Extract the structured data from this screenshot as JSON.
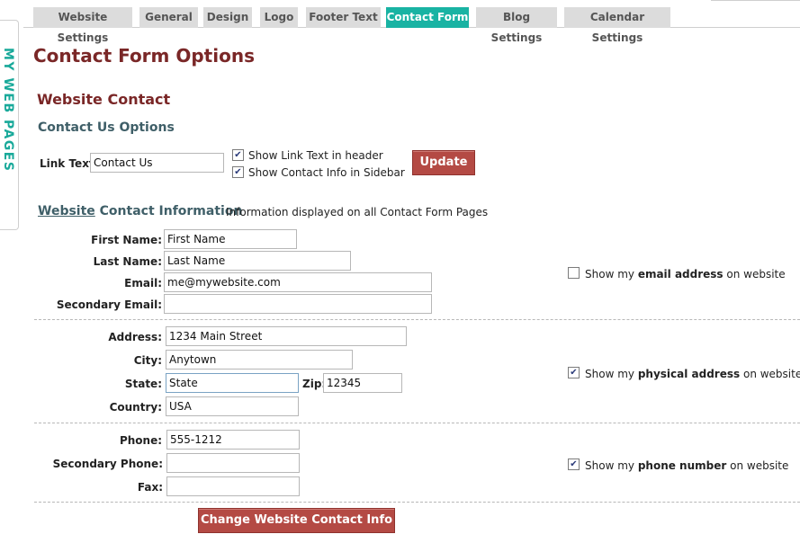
{
  "tabs": [
    {
      "label": "Website Settings"
    },
    {
      "label": "General"
    },
    {
      "label": "Design"
    },
    {
      "label": "Logo"
    },
    {
      "label": "Footer Text"
    },
    {
      "label": "Contact Form",
      "active": true
    },
    {
      "label": "Blog Settings"
    },
    {
      "label": "Calendar Settings"
    }
  ],
  "side_tab": "MY WEB PAGES",
  "page_title": "Contact Form Options",
  "section_title": "Website Contact",
  "options": {
    "title": "Contact Us Options",
    "link_text_label": "Link Text",
    "link_text_value": "Contact Us",
    "show_link_label": "Show Link Text in header",
    "show_link_checked": true,
    "show_info_label": "Show Contact Info in Sidebar",
    "show_info_checked": true,
    "update_label": "Update"
  },
  "info": {
    "title_word1": "Website",
    "title_word2": "Contact Information",
    "note": "Information displayed on all Contact Form Pages",
    "first_name_label": "First Name:",
    "first_name": "First Name",
    "last_name_label": "Last Name:",
    "last_name": "Last Name",
    "email_label": "Email:",
    "email": "me@mywebsite.com",
    "secondary_email_label": "Secondary Email:",
    "secondary_email": "",
    "address_label": "Address:",
    "address": "1234 Main Street",
    "city_label": "City:",
    "city": "Anytown",
    "state_label": "State:",
    "state": "State",
    "zip_label": "Zip:",
    "zip": "12345",
    "country_label": "Country:",
    "country": "USA",
    "phone_label": "Phone:",
    "phone": "555-1212",
    "secondary_phone_label": "Secondary Phone:",
    "secondary_phone": "",
    "fax_label": "Fax:",
    "fax": "",
    "show_email": {
      "pre": "Show my ",
      "bold": "email address",
      "post": " on website",
      "checked": false
    },
    "show_address": {
      "pre": "Show my ",
      "bold": "physical address",
      "post": " on website",
      "checked": true
    },
    "show_phone": {
      "pre": "Show my ",
      "bold": "phone number",
      "post": " on website",
      "checked": true
    },
    "change_button": "Change Website Contact Info"
  }
}
